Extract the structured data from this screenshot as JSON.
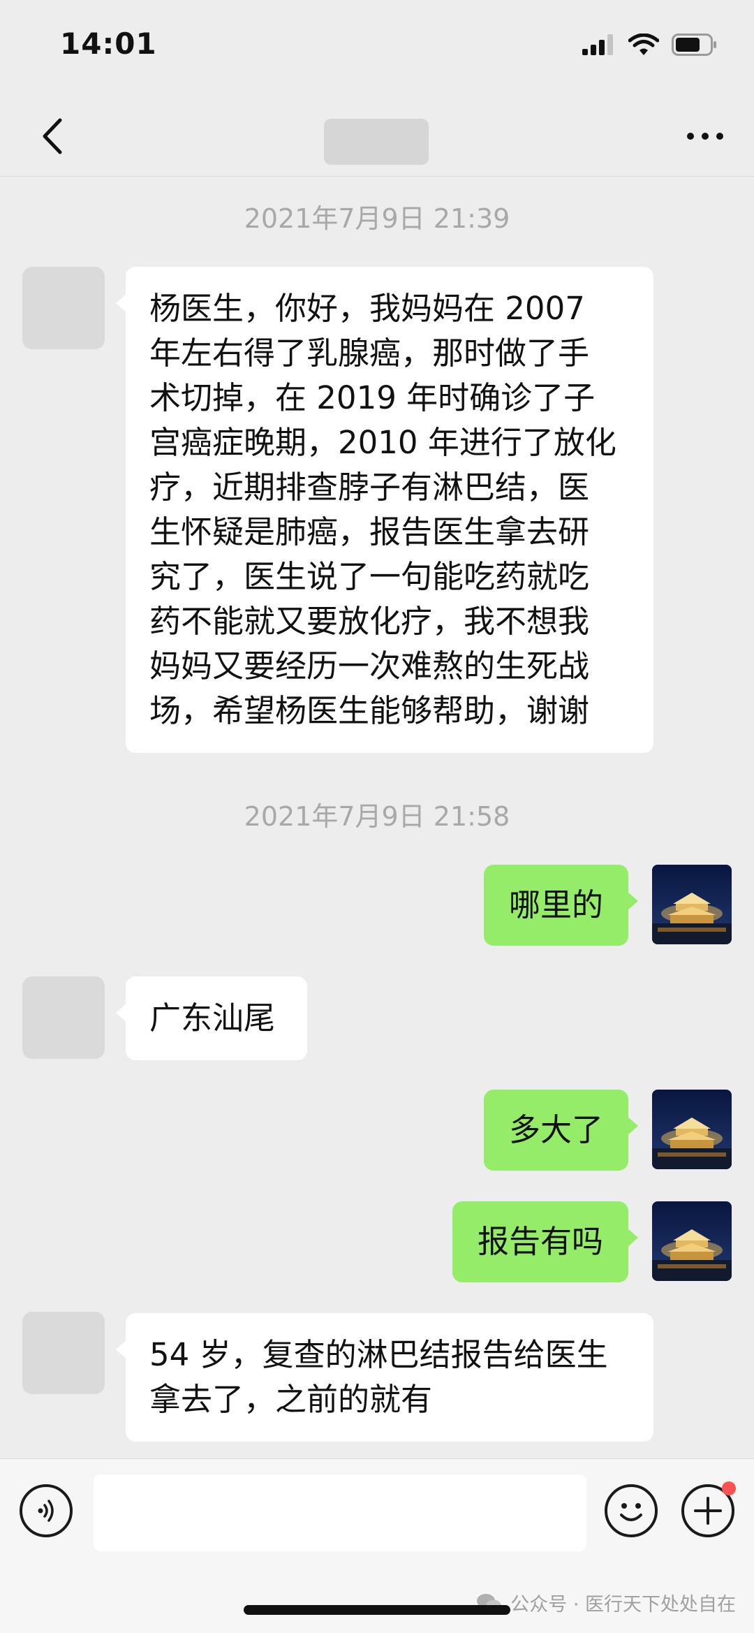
{
  "status_bar": {
    "time": "14:01",
    "icons": [
      "signal-icon",
      "wifi-icon",
      "battery-icon"
    ]
  },
  "nav": {
    "back_icon": "chevron-left-icon",
    "more_icon": "more-dots-icon"
  },
  "messages": [
    {
      "type": "timestamp",
      "text": "2021年7月9日 21:39"
    },
    {
      "type": "received",
      "lines": [
        "杨医生，你好，我妈妈在 2007",
        "年左右得了乳腺癌，那时做了手",
        "术切掉，在 2019 年时确诊了子",
        "宫癌症晚期，2010 年进行了放化",
        "疗，近期排查脖子有淋巴结，医",
        "生怀疑是肺癌，报告医生拿去研",
        "究了，医生说了一句能吃药就吃",
        "药不能就又要放化疗，我不想我",
        "妈妈又要经历一次难熬的生死战",
        "场，希望杨医生能够帮助，谢谢"
      ]
    },
    {
      "type": "timestamp",
      "text": "2021年7月9日 21:58"
    },
    {
      "type": "sent",
      "text": "哪里的"
    },
    {
      "type": "received",
      "lines": [
        "广东汕尾"
      ]
    },
    {
      "type": "sent",
      "text": "多大了"
    },
    {
      "type": "sent",
      "text": "报告有吗"
    },
    {
      "type": "received",
      "lines": [
        "54 岁，复查的淋巴结报告给医生",
        "拿去了，之前的就有"
      ]
    }
  ],
  "input_bar": {
    "voice_icon": "voice-icon",
    "emoji_icon": "emoji-icon",
    "plus_icon": "plus-icon",
    "input_value": "",
    "watermark": "公众号 · 医行天下处处自在"
  },
  "colors": {
    "sent_bubble": "#95ec69",
    "received_bubble": "#ffffff",
    "background": "#ededed",
    "badge": "#fa5151"
  }
}
